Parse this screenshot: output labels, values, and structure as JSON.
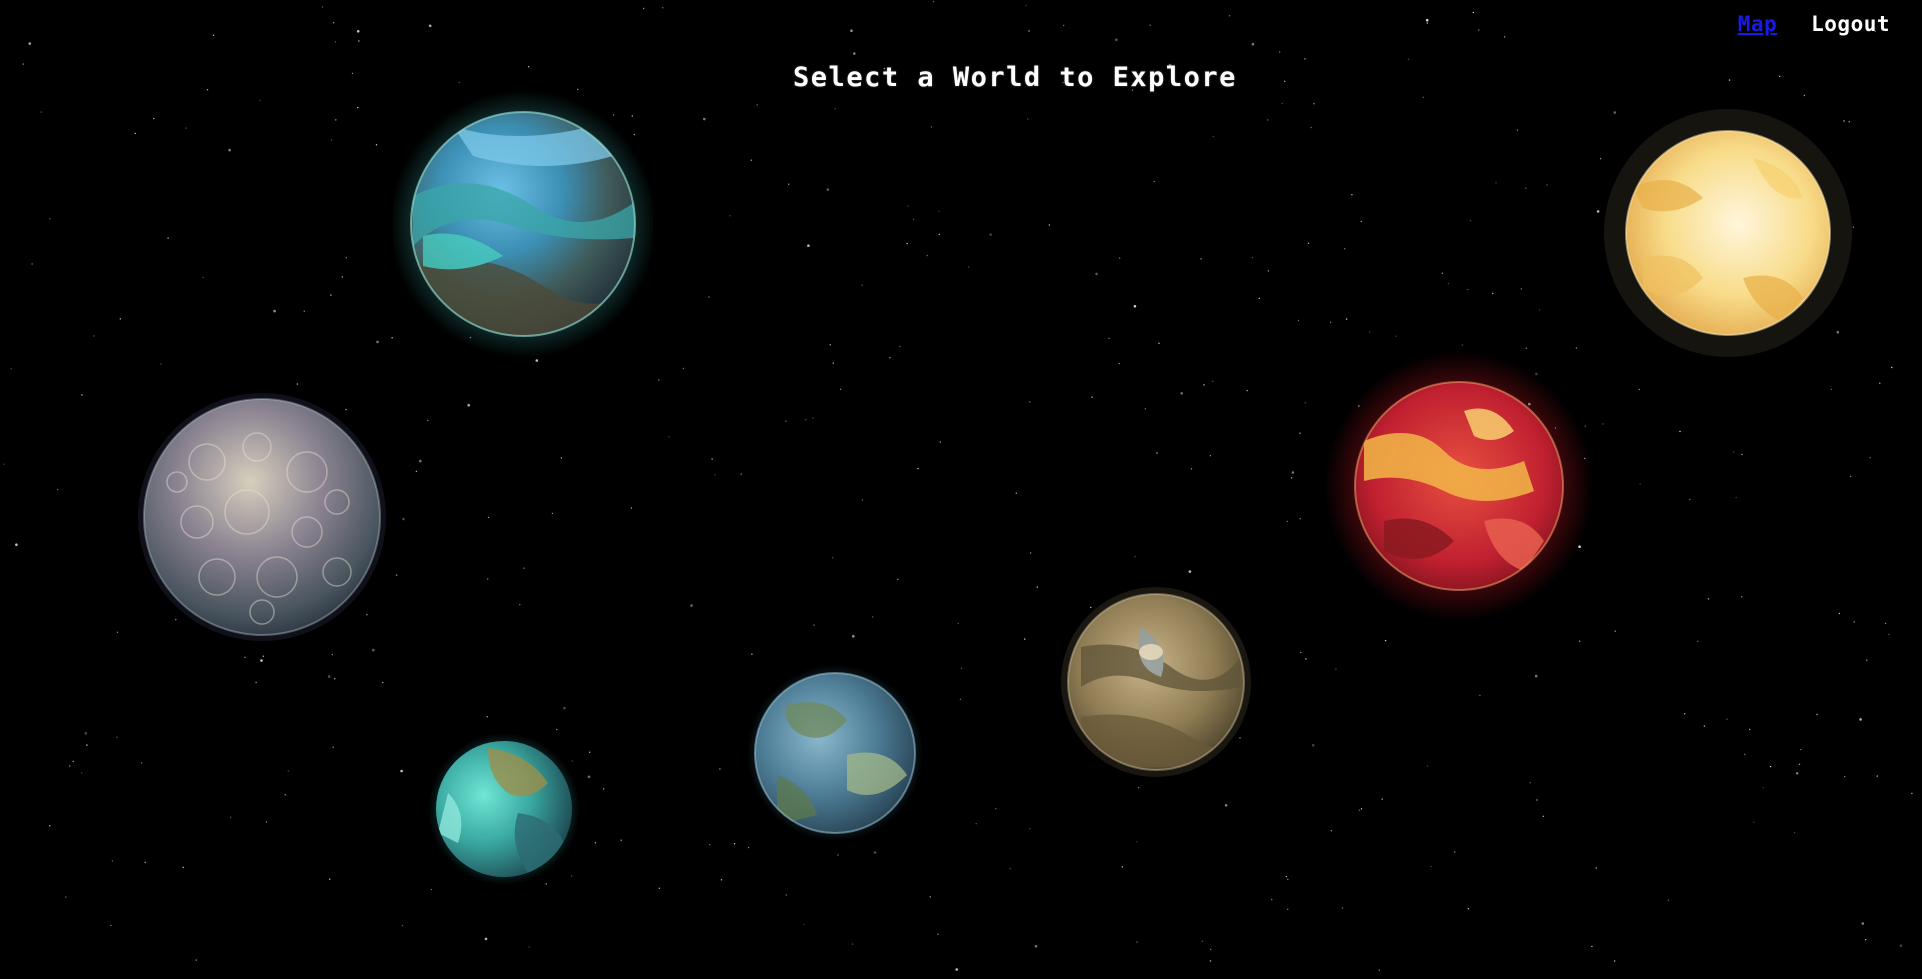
{
  "nav": {
    "map_label": "Map",
    "logout_label": "Logout",
    "map_color": "#1a1ae6",
    "logout_color": "#ffffff"
  },
  "page": {
    "title": "Select a World to Explore",
    "background": "#000000"
  },
  "planets": [
    {
      "name": "ocean-world",
      "palette": [
        "#5ab0d8",
        "#3a8f9c",
        "#4d4a35",
        "#2b6f7a"
      ],
      "glow": "#3fc8c0"
    },
    {
      "name": "cratered-moon",
      "palette": [
        "#bdb6a3",
        "#6f6a79",
        "#46525a",
        "#9a8f82"
      ],
      "glow": "#2a2a3a"
    },
    {
      "name": "turquoise-world",
      "palette": [
        "#4fd6c8",
        "#9c8f4a",
        "#2e6c74",
        "#6fc0b0"
      ],
      "glow": "#1e5c62"
    },
    {
      "name": "continental-world",
      "palette": [
        "#5a8fb0",
        "#6f8a5c",
        "#3c6a86",
        "#a3b88a"
      ],
      "glow": "#2e5a74"
    },
    {
      "name": "desert-world",
      "palette": [
        "#9c8a5e",
        "#c7b48c",
        "#5e5438",
        "#8fa0a8"
      ],
      "glow": "#3a3422"
    },
    {
      "name": "lava-world",
      "palette": [
        "#d8303a",
        "#f2b848",
        "#8a1a20",
        "#e86050"
      ],
      "glow": "#8a1018"
    },
    {
      "name": "sun-world",
      "palette": [
        "#f6d070",
        "#fbeec0",
        "#e8b048",
        "#fff6dc"
      ],
      "glow": "#2a2010"
    }
  ]
}
